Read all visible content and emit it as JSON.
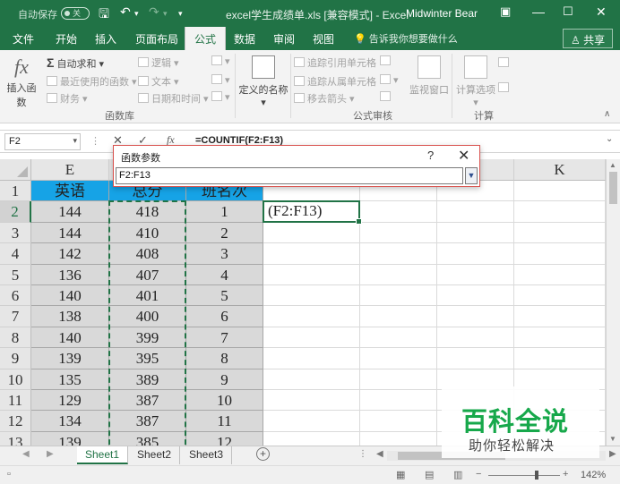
{
  "window": {
    "autosave_label": "自动保存",
    "autosave_state": "关",
    "title": "excel学生成绩单.xls [兼容模式] - Excel",
    "user": "Midwinter Bear",
    "accent": "#217346"
  },
  "tabs": [
    "文件",
    "开始",
    "插入",
    "页面布局",
    "公式",
    "数据",
    "审阅",
    "视图"
  ],
  "active_tab": "公式",
  "tell_me": "告诉我你想要做什么",
  "share_label": "共享",
  "ribbon": {
    "insert_function": "插入函数",
    "autosum": "自动求和",
    "recent": "最近使用的函数",
    "financial": "财务",
    "logical": "逻辑",
    "text": "文本",
    "datetime": "日期和时间",
    "defined_names": "定义的名称",
    "trace_precedents": "追踪引用单元格",
    "trace_dependents": "追踪从属单元格",
    "remove_arrows": "移去箭头",
    "watch_window": "监视窗口",
    "calc_options": "计算选项",
    "group_library": "函数库",
    "group_auditing": "公式审核",
    "group_calc": "计算"
  },
  "formula_bar": {
    "name_box": "F2",
    "formula": "=COUNTIF(F2:F13)"
  },
  "dialog": {
    "title": "函数参数",
    "help": "?",
    "close": "✕",
    "input_value": "F2:F13"
  },
  "columns": [
    "E",
    "F",
    "G",
    "",
    "",
    "",
    "K"
  ],
  "row_numbers": [
    "1",
    "2",
    "3",
    "4",
    "5",
    "6",
    "7",
    "8",
    "9",
    "10",
    "11",
    "12",
    "13"
  ],
  "headers": {
    "e": "英语",
    "f": "总分",
    "g": "班名次"
  },
  "rows": [
    {
      "e": "144",
      "f": "418",
      "g": "1"
    },
    {
      "e": "144",
      "f": "410",
      "g": "2"
    },
    {
      "e": "142",
      "f": "408",
      "g": "3"
    },
    {
      "e": "136",
      "f": "407",
      "g": "4"
    },
    {
      "e": "140",
      "f": "401",
      "g": "5"
    },
    {
      "e": "138",
      "f": "400",
      "g": "6"
    },
    {
      "e": "140",
      "f": "399",
      "g": "7"
    },
    {
      "e": "139",
      "f": "395",
      "g": "8"
    },
    {
      "e": "135",
      "f": "389",
      "g": "9"
    },
    {
      "e": "129",
      "f": "387",
      "g": "10"
    },
    {
      "e": "134",
      "f": "387",
      "g": "11"
    },
    {
      "e": "139",
      "f": "385",
      "g": "12"
    }
  ],
  "active_cell_text": "(F2:F13)",
  "sheets": [
    "Sheet1",
    "Sheet2",
    "Sheet3"
  ],
  "active_sheet": "Sheet1",
  "zoom": "142%",
  "watermark": {
    "title": "百科全说",
    "subtitle": "助你轻松解决"
  }
}
